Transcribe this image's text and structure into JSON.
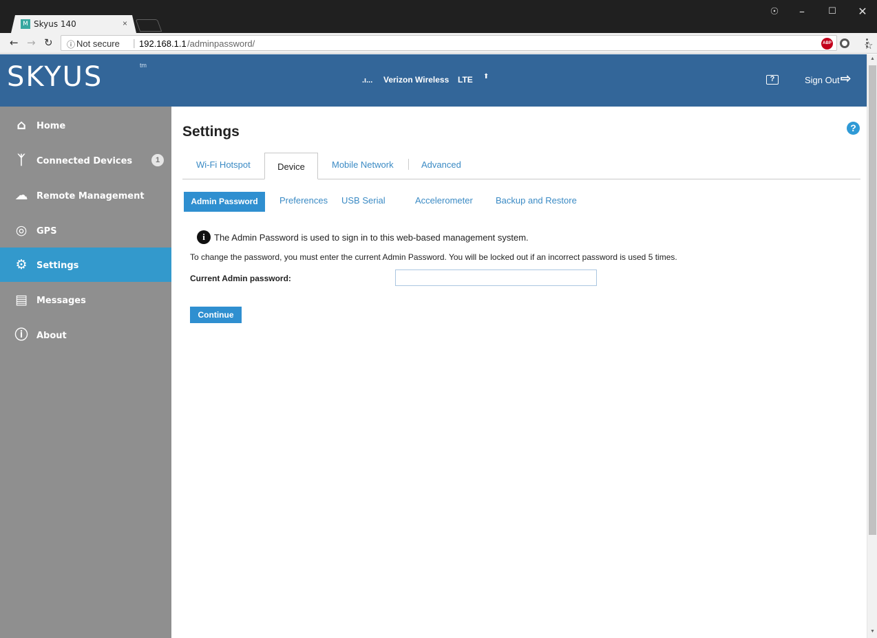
{
  "browser": {
    "tab_title": "Skyus 140",
    "tab_favicon": "M",
    "tab_close": "×",
    "security_label": "Not secure",
    "url_host": "192.168.1.1",
    "url_path": "/adminpassword/",
    "abp_label": "ABP",
    "icons": [
      "back-arrow-icon",
      "forward-arrow-icon",
      "reload-icon",
      "info-icon",
      "star-icon",
      "adblock-icon",
      "extension-icon",
      "menu-icon"
    ]
  },
  "header": {
    "logo": "SKYUS",
    "logo_tm": "tm",
    "signal_glyph": ".ı...",
    "carrier": "Verizon Wireless",
    "network_type": "LTE",
    "help_label": "?",
    "sign_out": "Sign Out",
    "background_color": "#336699"
  },
  "sidebar": {
    "background_color": "#8f8f8f",
    "active_color": "#3399cc",
    "items": [
      {
        "label": "Home",
        "icon": "home-icon"
      },
      {
        "label": "Connected Devices",
        "icon": "connected-devices-icon",
        "badge": "1"
      },
      {
        "label": "Remote Management",
        "icon": "cloud-icon"
      },
      {
        "label": "GPS",
        "icon": "gps-icon"
      },
      {
        "label": "Settings",
        "icon": "gear-icon",
        "active": true
      },
      {
        "label": "Messages",
        "icon": "message-icon"
      },
      {
        "label": "About",
        "icon": "info-circle-icon"
      }
    ]
  },
  "main": {
    "title": "Settings",
    "help_label": "?",
    "tabs": [
      {
        "label": "Wi-Fi Hotspot"
      },
      {
        "label": "Device",
        "active": true
      },
      {
        "label": "Mobile Network"
      },
      {
        "label": "Advanced"
      }
    ],
    "subtabs": [
      {
        "label": "Admin Password",
        "active": true
      },
      {
        "label": "Preferences"
      },
      {
        "label": "USB Serial"
      },
      {
        "label": "Accelerometer"
      },
      {
        "label": "Backup and Restore"
      }
    ],
    "info_glyph": "i",
    "info_text": "The Admin Password is used to sign in to this web-based management system.",
    "instructions": "To change the password, you must enter the current Admin Password. You will be locked out if an incorrect password is used 5 times.",
    "password_label": "Current Admin password:",
    "password_value": "",
    "continue_label": "Continue",
    "accent_color": "#2f8fd0"
  }
}
